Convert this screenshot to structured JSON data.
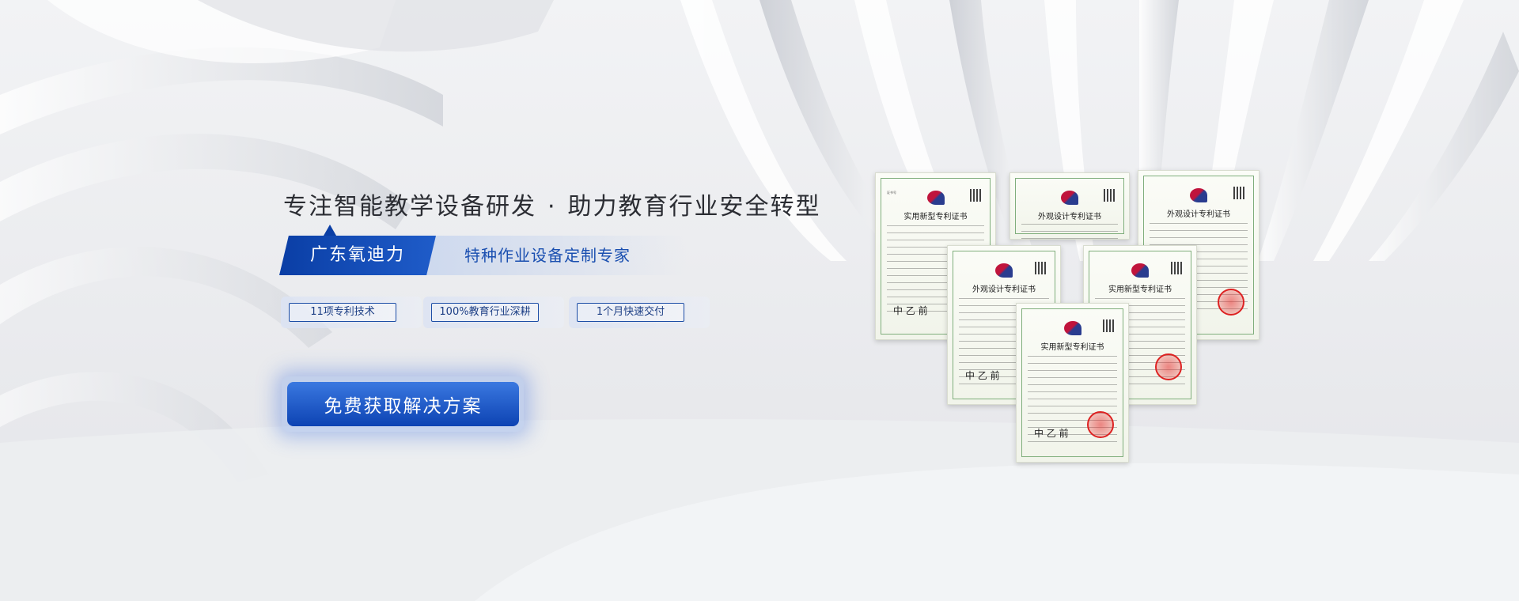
{
  "hero": {
    "headline_part1": "专注智能教学设备研发",
    "separator": "·",
    "headline_part2": "助力教育行业安全转型",
    "brand_name": "广东氧迪力",
    "brand_slogan": "特种作业设备定制专家",
    "features": [
      {
        "label": "11项专利技术"
      },
      {
        "label": "100%教育行业深耕"
      },
      {
        "label": "1个月快速交付"
      }
    ],
    "cta_label": "免费获取解决方案"
  },
  "certificates": [
    {
      "title": "实用新型专利证书"
    },
    {
      "title": "外观设计专利证书"
    },
    {
      "title": "外观设计专利证书"
    },
    {
      "title": "外观设计专利证书"
    },
    {
      "title": "实用新型专利证书"
    },
    {
      "title": "实用新型专利证书"
    }
  ],
  "colors": {
    "brand_blue": "#0a3ea5",
    "accent_blue": "#1f5cc9",
    "text_dark": "#2b2d33"
  }
}
